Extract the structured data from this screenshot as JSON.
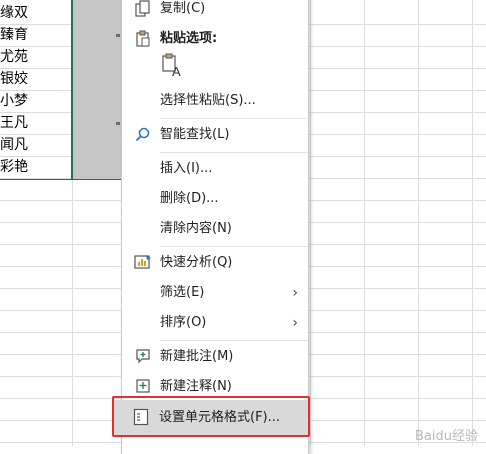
{
  "sheet": {
    "names": [
      "缘双",
      "臻育",
      "尤苑",
      "银姣",
      "小梦",
      "王凡",
      "闻凡",
      "彩艳"
    ]
  },
  "menu": {
    "copy": "复制(C)",
    "paste_options_title": "粘贴选项:",
    "paste_special": "选择性粘贴(S)...",
    "smart_lookup": "智能查找(L)",
    "insert": "插入(I)...",
    "delete": "删除(D)...",
    "clear_contents": "清除内容(N)",
    "quick_analysis": "快速分析(Q)",
    "filter": "筛选(E)",
    "sort": "排序(O)",
    "new_comment": "新建批注(M)",
    "new_note": "新建注释(N)",
    "format_cells": "设置单元格格式(F)..."
  },
  "icons": {
    "copy": "copy-icon",
    "paste": "paste-icon",
    "paste_sub": "paste-keep-text-icon",
    "smart_lookup": "search-icon",
    "quick_analysis": "quick-analysis-icon",
    "comment": "comment-icon",
    "note": "note-icon",
    "format_cells": "format-cells-icon"
  },
  "watermark": "Baidu经验"
}
